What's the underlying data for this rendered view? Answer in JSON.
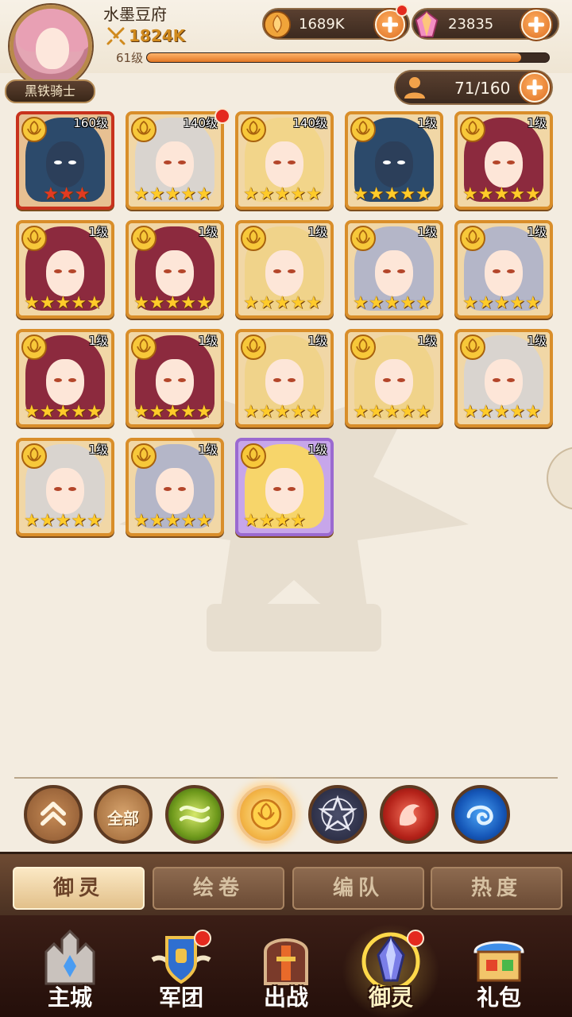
{
  "player": {
    "name": "水墨豆府",
    "power": "1824K",
    "level_label": "61级",
    "exp_fraction": 0.93,
    "title": "黑铁骑士"
  },
  "resources": {
    "gold": "1689K",
    "gems": "23835"
  },
  "roster_capacity": "71/160",
  "heroes": [
    {
      "level": "160级",
      "stars": 3,
      "frame": "red",
      "hair": "#2c4a6b",
      "helmet": true,
      "badge": false
    },
    {
      "level": "140级",
      "stars": 5,
      "frame": "gold",
      "hair": "#d9d4cf",
      "helmet": false,
      "badge": true
    },
    {
      "level": "140级",
      "stars": 5,
      "frame": "gold",
      "hair": "#f2d58a",
      "helmet": false,
      "badge": false
    },
    {
      "level": "1级",
      "stars": 5,
      "frame": "gold",
      "hair": "#2c4a6b",
      "helmet": true,
      "badge": false
    },
    {
      "level": "1级",
      "stars": 5,
      "frame": "gold",
      "hair": "#8c2a3e",
      "helmet": false,
      "badge": false
    },
    {
      "level": "1级",
      "stars": 5,
      "frame": "gold",
      "hair": "#8c2a3e",
      "helmet": false,
      "badge": false
    },
    {
      "level": "1级",
      "stars": 5,
      "frame": "gold",
      "hair": "#8c2a3e",
      "helmet": false,
      "badge": false
    },
    {
      "level": "1级",
      "stars": 5,
      "frame": "gold",
      "hair": "#f0d38a",
      "helmet": false,
      "badge": false
    },
    {
      "level": "1级",
      "stars": 5,
      "frame": "gold",
      "hair": "#b4b6c8",
      "helmet": false,
      "badge": false
    },
    {
      "level": "1级",
      "stars": 5,
      "frame": "gold",
      "hair": "#b4b6c8",
      "helmet": false,
      "badge": false
    },
    {
      "level": "1级",
      "stars": 5,
      "frame": "gold",
      "hair": "#8c2a3e",
      "helmet": false,
      "badge": false
    },
    {
      "level": "1级",
      "stars": 5,
      "frame": "gold",
      "hair": "#8c2a3e",
      "helmet": false,
      "badge": false
    },
    {
      "level": "1级",
      "stars": 5,
      "frame": "gold",
      "hair": "#f0d38a",
      "helmet": false,
      "badge": false
    },
    {
      "level": "1级",
      "stars": 5,
      "frame": "gold",
      "hair": "#f0d38a",
      "helmet": false,
      "badge": false
    },
    {
      "level": "1级",
      "stars": 5,
      "frame": "gold",
      "hair": "#d9d4cf",
      "helmet": false,
      "badge": false
    },
    {
      "level": "1级",
      "stars": 5,
      "frame": "gold",
      "hair": "#d9d4cf",
      "helmet": false,
      "badge": false
    },
    {
      "level": "1级",
      "stars": 5,
      "frame": "gold",
      "hair": "#b4b6c8",
      "helmet": false,
      "badge": false
    },
    {
      "level": "1级",
      "stars": 4,
      "frame": "purple",
      "hair": "#f7d56a",
      "helmet": false,
      "badge": false
    }
  ],
  "filters": {
    "all_label": "全部",
    "items": [
      "collapse-up",
      "all",
      "nature-element",
      "light-element",
      "dark-element",
      "fire-element",
      "water-element"
    ],
    "selected": "light-element"
  },
  "subtabs": {
    "items": [
      "御灵",
      "绘卷",
      "编队",
      "热度"
    ],
    "active": "御灵"
  },
  "nav": {
    "items": [
      {
        "label": "主城",
        "icon": "castle-icon",
        "badge": false
      },
      {
        "label": "军团",
        "icon": "legion-shield-icon",
        "badge": true
      },
      {
        "label": "出战",
        "icon": "battle-gate-icon",
        "badge": false
      },
      {
        "label": "御灵",
        "icon": "spirit-crystal-icon",
        "badge": true
      },
      {
        "label": "礼包",
        "icon": "gift-shop-icon",
        "badge": false
      }
    ],
    "active": "御灵"
  },
  "colors": {
    "accent_orange": "#e27825",
    "frame_gold": "#d98e2a",
    "frame_red": "#c8321d",
    "frame_purple": "#9b6ad0",
    "badge_red": "#e42a1e"
  }
}
